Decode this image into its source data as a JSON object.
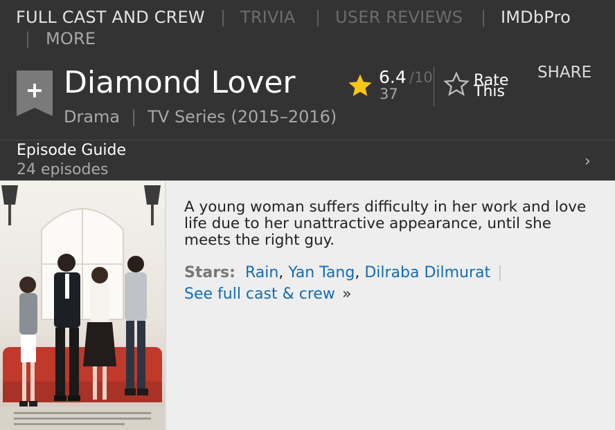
{
  "nav": {
    "full_cast": "FULL CAST AND CREW",
    "trivia": "TRIVIA",
    "user_reviews": "USER REVIEWS",
    "imdbpro": "IMDbPro",
    "more": "MORE",
    "separator": "|"
  },
  "title_block": {
    "watchlist_icon": "plus-ribbon",
    "title": "Diamond Lover",
    "genre": "Drama",
    "type": "TV Series (2015–2016)",
    "separator": "|",
    "rating": "6.4",
    "rating_max": "/10",
    "votes": "37",
    "rate_line1": "Rate",
    "rate_line2": "This",
    "share": "SHARE"
  },
  "episode_guide": {
    "label": "Episode Guide",
    "count": "24 episodes",
    "chevron": "›"
  },
  "main": {
    "plot": "A young woman suffers difficulty in her work and love life due to her unattractive appearance, until she meets the right guy.",
    "stars_label": "Stars:",
    "stars": [
      "Rain",
      "Yan Tang",
      "Dilraba Dilmurat"
    ],
    "comma": ",",
    "pipe": "|",
    "see_full_cast": "See full cast & crew",
    "raquo": "»"
  },
  "colors": {
    "background": "#333333",
    "content_bg": "#eeeeee",
    "link": "#136cb2",
    "star": "#f5c518"
  }
}
